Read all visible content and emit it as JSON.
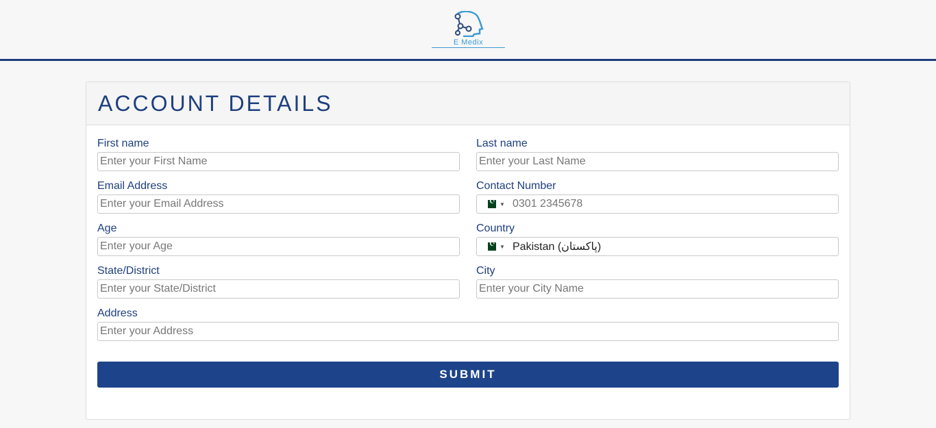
{
  "header": {
    "logo_text": "E Medix",
    "accent_color": "#1d3f7e"
  },
  "form": {
    "title": "ACCOUNT DETAILS",
    "first_name": {
      "label": "First name",
      "placeholder": "Enter your First Name"
    },
    "last_name": {
      "label": "Last name",
      "placeholder": "Enter your Last Name"
    },
    "email": {
      "label": "Email Address",
      "placeholder": "Enter your Email Address"
    },
    "contact": {
      "label": "Contact Number",
      "placeholder": "0301 2345678",
      "flag_icon": "pakistan-flag-icon"
    },
    "age": {
      "label": "Age",
      "placeholder": "Enter your Age"
    },
    "country": {
      "label": "Country",
      "value": "Pakistan (‫پاکستان‬‎)",
      "flag_icon": "pakistan-flag-icon"
    },
    "state": {
      "label": "State/District",
      "placeholder": "Enter your State/District"
    },
    "city": {
      "label": "City",
      "placeholder": "Enter your City Name"
    },
    "address": {
      "label": "Address",
      "placeholder": "Enter your Address"
    },
    "submit_label": "SUBMIT",
    "submit_color": "#1d448a"
  }
}
